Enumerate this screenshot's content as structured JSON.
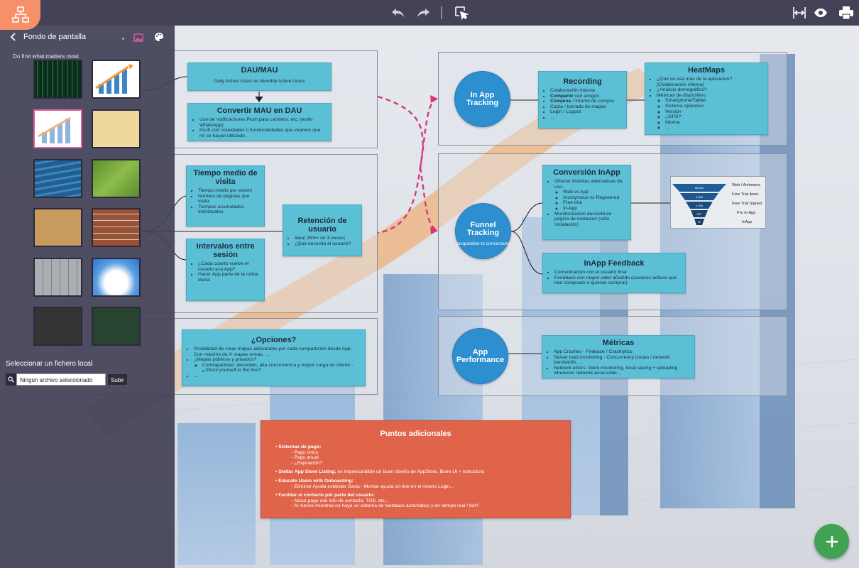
{
  "toolbar": {
    "undo": "undo-icon",
    "redo": "redo-icon",
    "select": "cursor-select-icon",
    "fit": "fit-width-icon",
    "preview": "eye-icon",
    "print": "printer-icon"
  },
  "sidebar": {
    "title": "Fondo de pantalla",
    "subtitle": "Do first what matters most",
    "local_label": "Seleccionar un fichero local",
    "file_placeholder": "Ningún archivo seleccionado",
    "upload_button": "Subir"
  },
  "nodes": {
    "dau_title": "DAU/MAU",
    "dau_text": "Daily Active Users vs Monthly Active Users",
    "mau_title": "Convertir MAU en DAU",
    "mau_items": [
      "Uso de notificaciones Push para cambios, etc. (estilo WhatsApp)",
      "Push con novedades o funcionalidades que veamos que no se hayan utilizado."
    ],
    "tiempo_title": "Tiempo medio de visita",
    "tiempo_items": [
      "Tiempo medio por sesión",
      "Número de páginas que visita",
      "Tiempos acumulados, individuales"
    ],
    "intervalos_title": "Intervalos entre sesión",
    "intervalos_items": [
      "¿Cada cuanto vuelve el usuario a la App?",
      "Hacer App parte de la rutina diaria"
    ],
    "retencion_title": "Retención de usuario",
    "retencion_items": [
      "Ideal 25%+ en 3 meses",
      "¿Qué necesita el usuario?"
    ],
    "opciones_title": "¿Opciones?",
    "opciones_items": [
      "Posibilidad de crear mapas adicionales por cada compartición desde App. Con máximo de X mapas extras, ...",
      "¿Mapas públicos y privados?"
    ],
    "opciones_sub_lead": "Contrapartidas: desorden, alta concurrencia y mayor carga en cliente - ",
    "opciones_sub_em": "¿Shoot yourself in the foot?",
    "opciones_last": "...",
    "inapp_tracking": "In App Tracking",
    "recording_title": "Recording",
    "rec_1": "Colaboración interna",
    "rec_2b": "Compartir",
    "rec_2": " con amigos",
    "rec_3b": "Compras",
    "rec_3": " / Intento de compra",
    "rec_4": "Copia / borrado de mapas",
    "rec_5": "Login / Logout",
    "rec_6": "...",
    "heat_title": "HeatMaps",
    "heat_1": "¿Qué se usa más de la aplicación?",
    "heat_1b": "[Colaboración interna]",
    "heat_2": "¿Análisis demográfico?",
    "heat_3": "Métricas de dispositivo:",
    "heat_sub": [
      "Smartphone/Tablet",
      "Sistema operativo",
      "Versión",
      "¿GPS?",
      "Idioma",
      "..."
    ],
    "funnel_title": "Funnel Tracking",
    "funnel_sub": "(acquisition to conversion)",
    "conv_title": "Conversión InApp",
    "conv_1": "Ofrecer distintas alternativas de uso:",
    "conv_sub": [
      "Web vs App",
      "Anonymous vs Registered",
      "Free trial",
      "In-App"
    ],
    "conv_2": "Monitorización deviceId en página de invitación (ratio instalación)",
    "funnel_values": [
      "50,431",
      "3,309",
      "1,530",
      "537",
      "92"
    ],
    "funnel_labels": [
      "Web / Anónimos",
      "Free Trial Anon.",
      "Free Trial Signed",
      "Pre In-App",
      "InApp"
    ],
    "feedback_title": "InApp Feedback",
    "feedback_items": [
      "Comunicación con el usuario final",
      "Feedback con mayor valor añadido (usuarios activos que han comprado o quieren comprar)"
    ],
    "perf_title": "App Performance",
    "metricas_title": "Métricas",
    "metricas_items": [
      "App Crashes - Firebase / Crashlytics",
      "Server load monitoring - Concurrency issues / network bandwidth, ...",
      "Network errors: client monitoring, local saving + uploading whenever network accessible..."
    ],
    "puntos_title": "Puntos adicionales",
    "p1_title": "Sistemas de pago:",
    "p1_items": [
      "Pago único",
      "Pago anual",
      "¿Expiración?"
    ],
    "p2_title": "Stellar App Store Listing:",
    "p2_text": " es imprescindible un buen diseño de AppStore. Buen UI + estructura",
    "p3_title": "Educate Users with Onboarding:",
    "p3_items": [
      "Eliminar Ayuda estándar Savia - Montar ayuda on-line en el mismo Login..."
    ],
    "p4_title": "Facilitar el contacto por parte del usuario:",
    "p4_items": [
      "About page con info de contacto, TOS, etc...",
      "Al menos mientras no haya un sistema de feedback automático y en tiempo real / bot?"
    ]
  },
  "colors": {
    "accent": "#f5906a",
    "node": "#5bbfd6",
    "circle": "#2d8fcf",
    "red": "#e0644a",
    "fab": "#41a154"
  }
}
